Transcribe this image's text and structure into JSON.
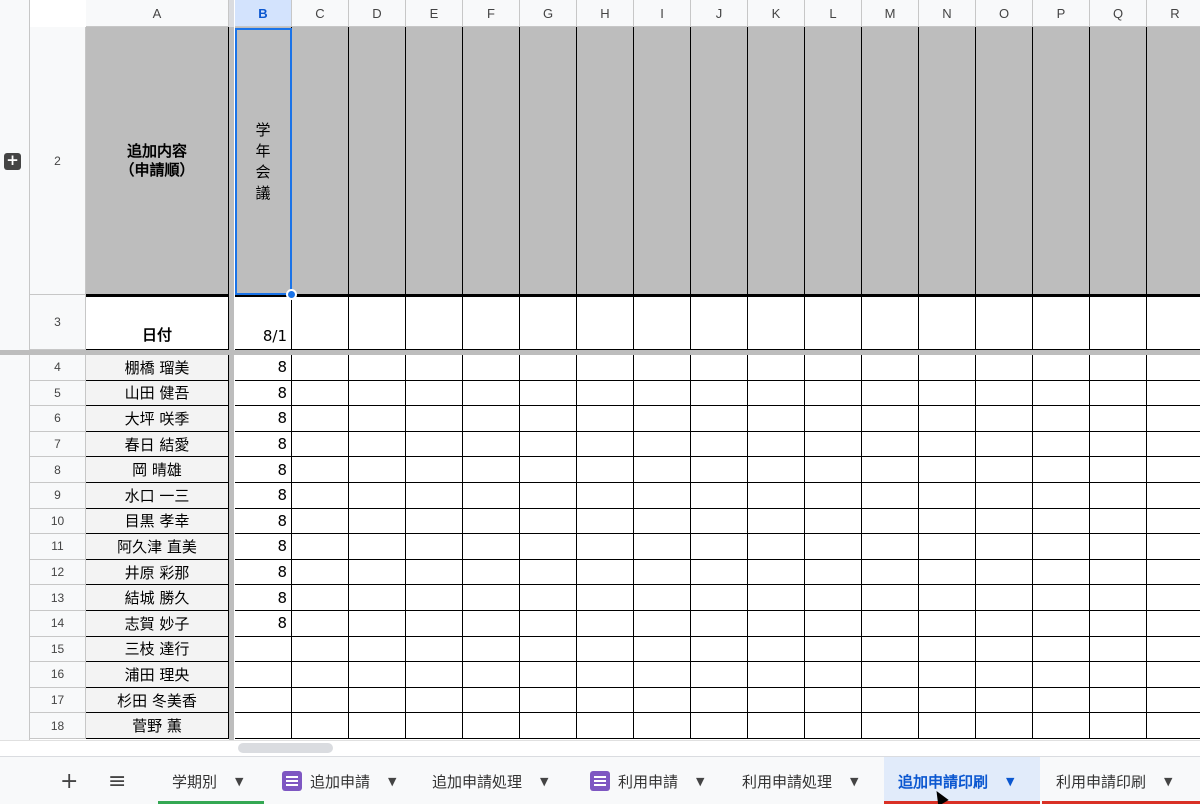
{
  "columns": [
    {
      "key": "A",
      "label": "A"
    },
    {
      "key": "B",
      "label": "B"
    },
    {
      "key": "C",
      "label": "C"
    },
    {
      "key": "D",
      "label": "D"
    },
    {
      "key": "E",
      "label": "E"
    },
    {
      "key": "F",
      "label": "F"
    },
    {
      "key": "G",
      "label": "G"
    },
    {
      "key": "H",
      "label": "H"
    },
    {
      "key": "I",
      "label": "I"
    },
    {
      "key": "J",
      "label": "J"
    },
    {
      "key": "K",
      "label": "K"
    },
    {
      "key": "L",
      "label": "L"
    },
    {
      "key": "M",
      "label": "M"
    },
    {
      "key": "N",
      "label": "N"
    },
    {
      "key": "O",
      "label": "O"
    },
    {
      "key": "P",
      "label": "P"
    },
    {
      "key": "Q",
      "label": "Q"
    },
    {
      "key": "R",
      "label": "R"
    }
  ],
  "selected_column": "B",
  "header_rows": {
    "row2": {
      "number": "2",
      "a_label": "追加内容\n（申請順）",
      "b_value": "学年会議"
    },
    "row3": {
      "number": "3",
      "a_label": "日付",
      "b_value": "8/1"
    }
  },
  "data_rows": [
    {
      "number": "4",
      "name": "棚橋 瑠美",
      "b": "8"
    },
    {
      "number": "5",
      "name": "山田 健吾",
      "b": "8"
    },
    {
      "number": "6",
      "name": "大坪 咲季",
      "b": "8"
    },
    {
      "number": "7",
      "name": "春日 結愛",
      "b": "8"
    },
    {
      "number": "8",
      "name": "岡 晴雄",
      "b": "8"
    },
    {
      "number": "9",
      "name": "水口 一三",
      "b": "8"
    },
    {
      "number": "10",
      "name": "目黒 孝幸",
      "b": "8"
    },
    {
      "number": "11",
      "name": "阿久津 直美",
      "b": "8"
    },
    {
      "number": "12",
      "name": "井原 彩那",
      "b": "8"
    },
    {
      "number": "13",
      "name": "結城 勝久",
      "b": "8"
    },
    {
      "number": "14",
      "name": "志賀 妙子",
      "b": "8"
    },
    {
      "number": "15",
      "name": "三枝 達行",
      "b": ""
    },
    {
      "number": "16",
      "name": "浦田 理央",
      "b": ""
    },
    {
      "number": "17",
      "name": "杉田 冬美香",
      "b": ""
    },
    {
      "number": "18",
      "name": "菅野 薫",
      "b": ""
    }
  ],
  "expand_icon": "plus-box-icon",
  "tabbar": {
    "add_icon": "plus-icon",
    "add_symbol": "+",
    "menu_icon": "hamburger-menu-icon",
    "menu_symbol": "≡",
    "tabs": [
      {
        "label": "学期別",
        "has_form_icon": false,
        "active": false,
        "underline": "#34a853"
      },
      {
        "label": "追加申請",
        "has_form_icon": true,
        "active": false,
        "underline": ""
      },
      {
        "label": "追加申請処理",
        "has_form_icon": false,
        "active": false,
        "underline": ""
      },
      {
        "label": "利用申請",
        "has_form_icon": true,
        "active": false,
        "underline": ""
      },
      {
        "label": "利用申請処理",
        "has_form_icon": false,
        "active": false,
        "underline": ""
      },
      {
        "label": "追加申請印刷",
        "has_form_icon": false,
        "active": true,
        "underline": "#d93025"
      },
      {
        "label": "利用申請印刷",
        "has_form_icon": false,
        "active": false,
        "underline": "#d93025"
      }
    ],
    "caret_symbol": "▼"
  },
  "colors": {
    "header_fill": "#bdbdbd",
    "name_fill": "#f3f3f3",
    "selection": "#1a73e8",
    "active_tab_bg": "#e1ebfa",
    "active_tab_text": "#0b57d0"
  }
}
